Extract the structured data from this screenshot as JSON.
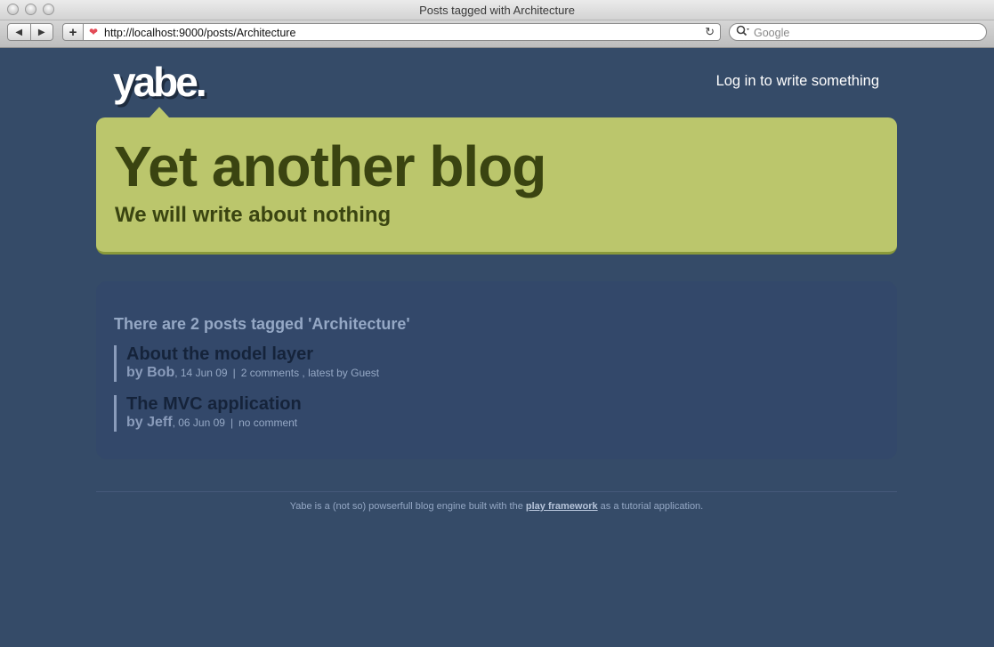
{
  "window": {
    "title": "Posts tagged with Architecture"
  },
  "toolbar": {
    "back_glyph": "◀",
    "forward_glyph": "▶",
    "add_glyph": "+",
    "url": "http://localhost:9000/posts/Architecture",
    "reload_glyph": "↻",
    "search_placeholder": "Google"
  },
  "header": {
    "logo": "yabe.",
    "login_link": "Log in to write something"
  },
  "banner": {
    "title": "Yet another blog",
    "subtitle": "We will write about nothing"
  },
  "main": {
    "heading": "There are 2 posts tagged 'Architecture'",
    "posts": [
      {
        "title": "About the model layer",
        "by": "by Bob",
        "date": ", 14 Jun 09",
        "separator": "|",
        "comments": "2 comments",
        "latest": " , latest by Guest"
      },
      {
        "title": "The MVC application",
        "by": "by Jeff",
        "date": ", 06 Jun 09",
        "separator": "|",
        "comments": "no comment",
        "latest": ""
      }
    ]
  },
  "footer": {
    "text_before": "Yabe is a (not so) powserfull blog engine built with the ",
    "link": "play framework",
    "text_after": " as a tutorial application."
  },
  "colors": {
    "page_background": "#354b68",
    "banner_background": "#bbc66c",
    "banner_text": "#3a4411",
    "muted_text": "#95a8c5"
  }
}
